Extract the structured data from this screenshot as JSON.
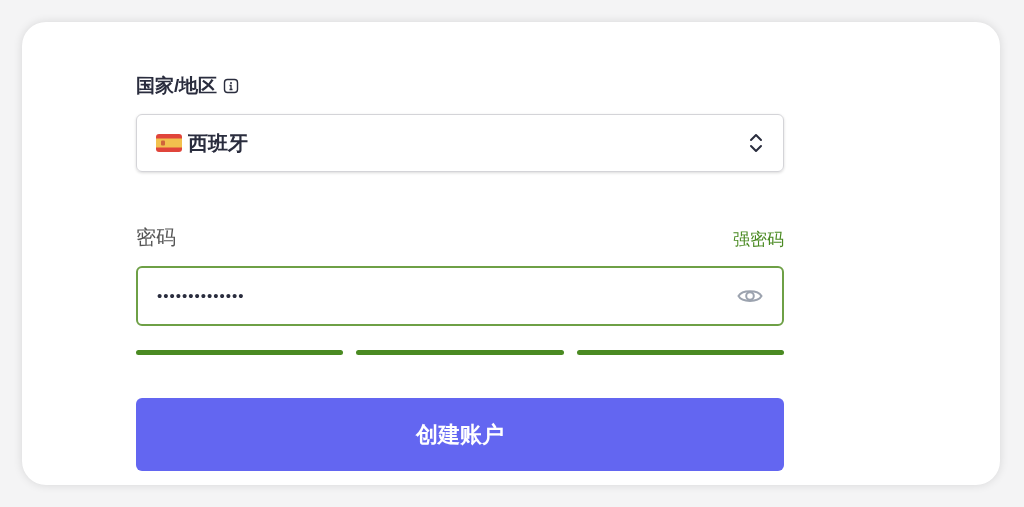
{
  "country_field": {
    "label": "国家/地区",
    "value": "西班牙"
  },
  "password_field": {
    "label": "密码",
    "strength_label": "强密码",
    "value": "••••••••••••••",
    "strength_segments": [
      {
        "filled": true
      },
      {
        "filled": true
      },
      {
        "filled": true
      }
    ]
  },
  "submit_button": {
    "label": "创建账户"
  }
}
